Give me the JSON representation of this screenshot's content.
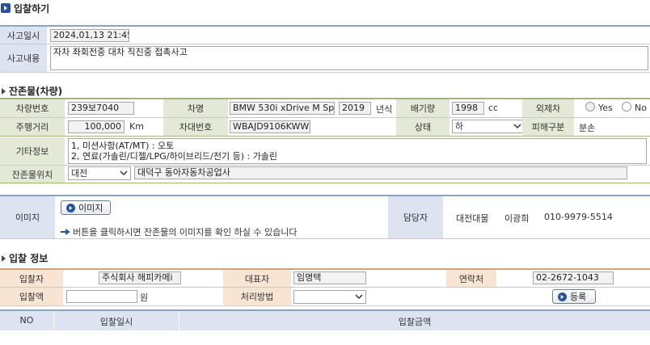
{
  "header": {
    "title": "입찰하기"
  },
  "accident": {
    "date_label": "사고일시",
    "date_value": "2024,01,13 21:45",
    "content_label": "사고내용",
    "content_value": "자차 좌회전중 대차 직진중 접촉사고"
  },
  "remains": {
    "section_title": "잔존물(차량)",
    "car_no_label": "차량번호",
    "car_no": "239보7040",
    "car_name_label": "차명",
    "car_name": "BMW 530i xDrive M Sp",
    "year": "2019",
    "year_unit": "년식",
    "disp_label": "배기량",
    "disp": "1998",
    "disp_unit": "cc",
    "foreign_label": "외제차",
    "yes": "Yes",
    "no": "No",
    "mileage_label": "주행거리",
    "mileage": "100,000",
    "mileage_unit": "Km",
    "vin_label": "차대번호",
    "vin": "WBAJD9106KWW•",
    "status_label": "상태",
    "status": "하",
    "type_label": "피해구분",
    "type_value": "분손",
    "etc_label": "기타정보",
    "etc_line1": "1, 미션사항(AT/MT) : 오토",
    "etc_line2": "2, 연료(가솔린/디젤/LPG/하이브리드/전기 등) : 가솔린",
    "loc_label": "잔존물위치",
    "loc_region": "대전",
    "loc_detail": "대덕구 동아자동차공업사"
  },
  "image": {
    "label": "이미지",
    "button": "이미지",
    "hint": "버튼을 클릭하시면 잔존물의 이미지를 확인 하실 수 있습니다",
    "manager_label": "담당자",
    "manager_org": "대전대물",
    "manager_name": "이광희",
    "manager_phone": "010-9979-5514"
  },
  "bid": {
    "section_title": "입찰 정보",
    "bidder_label": "입찰자",
    "bidder": "주식회사 해피카메i",
    "rep_label": "대표자",
    "rep": "임명택",
    "contact_label": "연락처",
    "contact": "02-2672-1043",
    "amount_label": "입찰액",
    "amount": "",
    "amount_unit": "원",
    "method_label": "처리방법",
    "method": "",
    "register_button": "등록"
  },
  "table": {
    "columns": [
      "NO",
      "입찰일시",
      "입찰금액"
    ]
  },
  "colors": {
    "label_green": "#e3e9d6",
    "label_blue": "#dde3f0",
    "label_peach": "#f7e4d3",
    "accent": "#27539c"
  }
}
